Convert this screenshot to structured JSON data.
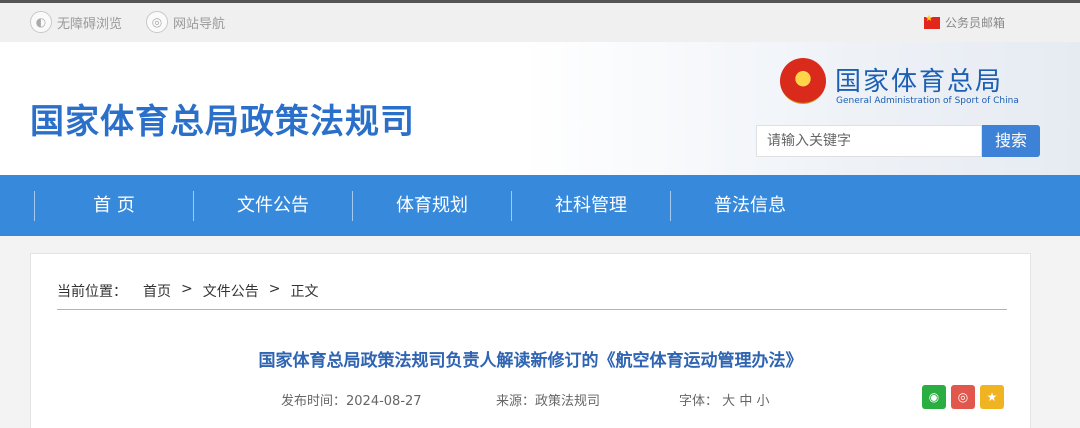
{
  "topbar": {
    "accessibility": "无障碍浏览",
    "sitemap": "网站导航",
    "mail": "公务员邮箱"
  },
  "header": {
    "site_title": "国家体育总局政策法规司",
    "org_cn": "国家体育总局",
    "org_en": "General Administration of Sport of China",
    "search_placeholder": "请输入关键字",
    "search_button": "搜索"
  },
  "nav": {
    "items": [
      "首 页",
      "文件公告",
      "体育规划",
      "社科管理",
      "普法信息"
    ]
  },
  "breadcrumb": {
    "label": "当前位置：",
    "items": [
      "首页",
      "文件公告",
      "正文"
    ],
    "separator": ">"
  },
  "article": {
    "title": "国家体育总局政策法规司负责人解读新修订的《航空体育运动管理办法》",
    "date_label": "发布时间：",
    "date": "2024-08-27",
    "source_label": "来源：",
    "source": "政策法规司",
    "font_label": "字体：",
    "font_sizes": [
      "大",
      "中",
      "小"
    ]
  },
  "share": {
    "icons": [
      "wechat-icon",
      "weibo-icon",
      "star-icon"
    ],
    "colors": [
      "#2aae41",
      "#e2574c",
      "#f0b322"
    ]
  },
  "colors": {
    "brand_blue": "#3789dc",
    "title_blue": "#2a6fc9"
  }
}
